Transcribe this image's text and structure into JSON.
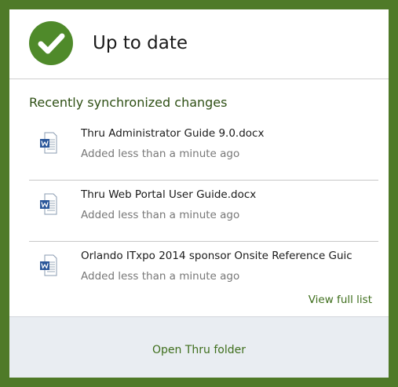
{
  "header": {
    "status_title": "Up to date",
    "status_icon": "checkmark-icon",
    "accent_color": "#4f8a2a"
  },
  "recent": {
    "section_title": "Recently synchronized changes",
    "items": [
      {
        "name": "Thru Administrator Guide 9.0.docx",
        "status": "Added less than a minute ago",
        "icon": "word-document-icon"
      },
      {
        "name": "Thru Web Portal User Guide.docx",
        "status": "Added less than a minute ago",
        "icon": "word-document-icon"
      },
      {
        "name": "Orlando ITxpo 2014 sponsor Onsite Reference Guic",
        "status": "Added less than a minute ago",
        "icon": "word-document-icon"
      }
    ],
    "view_full_list_label": "View full list"
  },
  "footer": {
    "open_folder_label": "Open Thru folder"
  }
}
